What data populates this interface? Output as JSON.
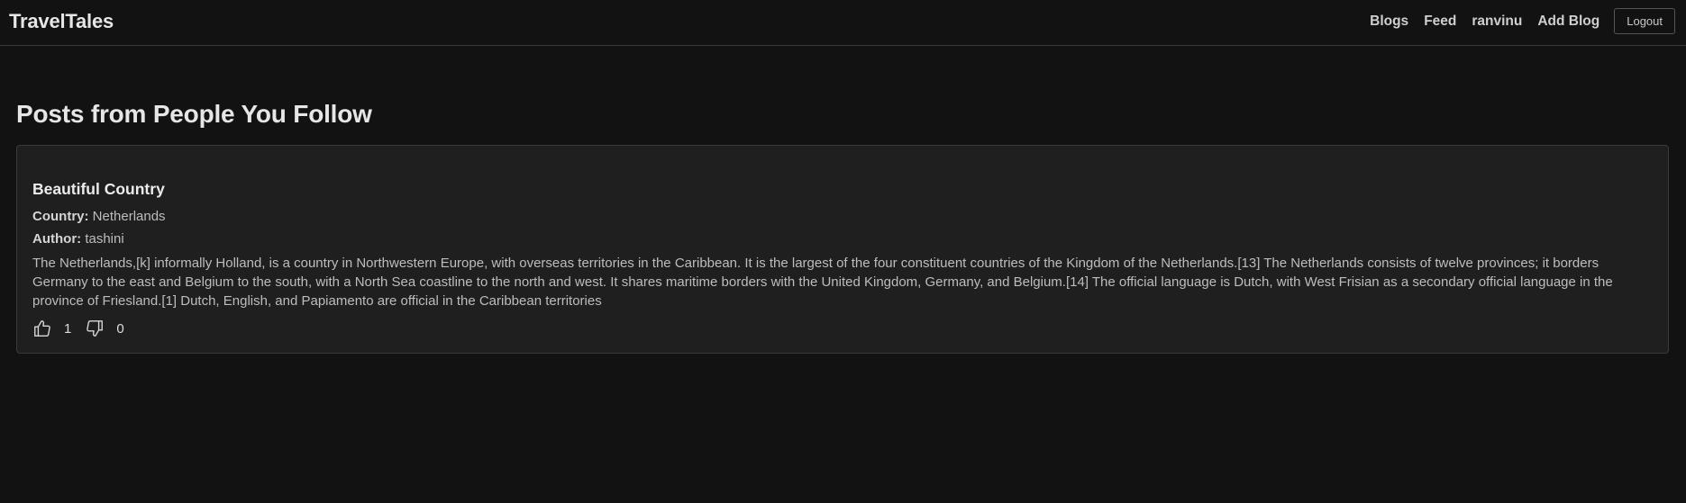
{
  "navbar": {
    "brand": "TravelTales",
    "links": [
      "Blogs",
      "Feed",
      "ranvinu",
      "Add Blog"
    ],
    "logout_label": "Logout"
  },
  "page": {
    "title": "Posts from People You Follow"
  },
  "posts": [
    {
      "title": "Beautiful Country",
      "country_label": "Country:",
      "country": "Netherlands",
      "author_label": "Author:",
      "author": "tashini",
      "body": "The Netherlands,[k] informally Holland, is a country in Northwestern Europe, with overseas territories in the Caribbean. It is the largest of the four constituent countries of the Kingdom of the Netherlands.[13] The Netherlands consists of twelve provinces; it borders Germany to the east and Belgium to the south, with a North Sea coastline to the north and west. It shares maritime borders with the United Kingdom, Germany, and Belgium.[14] The official language is Dutch, with West Frisian as a secondary official language in the province of Friesland.[1] Dutch, English, and Papiamento are official in the Caribbean territories",
      "likes": "1",
      "dislikes": "0",
      "icons": {
        "like": "thumbs-up-icon",
        "dislike": "thumbs-down-icon"
      }
    }
  ],
  "colors": {
    "background": "#121212",
    "card": "#1f1f1f",
    "border": "#3a3a3a",
    "text": "#e8e8e8"
  }
}
